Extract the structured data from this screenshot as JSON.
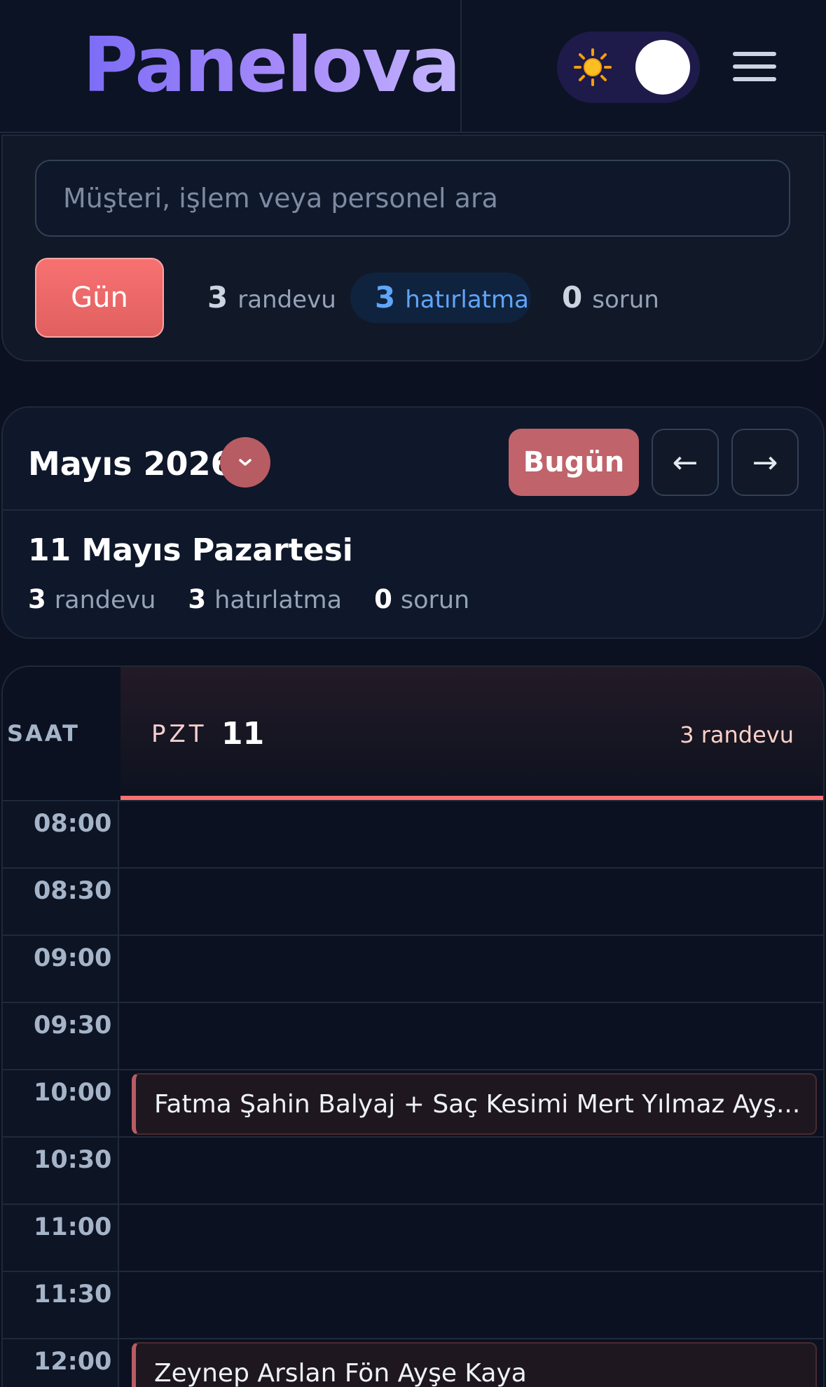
{
  "header": {
    "logo": "Panelova",
    "theme_toggle_icon": "sun-icon",
    "menu_icon": "hamburger-menu-icon"
  },
  "filters": {
    "search_placeholder": "Müşteri, işlem veya personel ara",
    "view_button": "Gün",
    "stats": [
      {
        "count": "3",
        "label": "randevu"
      },
      {
        "count": "3",
        "label": "hatırlatma"
      },
      {
        "count": "0",
        "label": "sorun"
      }
    ]
  },
  "month_nav": {
    "title": "Mayıs 2026",
    "today_button": "Bugün",
    "prev_label": "←",
    "next_label": "→"
  },
  "day_summary": {
    "title": "11 Mayıs Pazartesi",
    "stats": [
      {
        "count": "3",
        "label": "randevu"
      },
      {
        "count": "3",
        "label": "hatırlatma"
      },
      {
        "count": "0",
        "label": "sorun"
      }
    ]
  },
  "calendar": {
    "time_header": "SAAT",
    "day_of_week": "PZT",
    "day_number": "11",
    "day_count": "3 randevu",
    "accent_color": "#f87171",
    "times": [
      "08:00",
      "08:30",
      "09:00",
      "09:30",
      "10:00",
      "10:30",
      "11:00",
      "11:30",
      "12:00"
    ],
    "events": [
      {
        "time": "10:00",
        "text": "Fatma Şahin Balyaj + Saç Kesimi Mert Yılmaz Ayş..."
      },
      {
        "time": "12:00",
        "text": "Zeynep Arslan Fön Ayşe Kaya"
      }
    ]
  }
}
